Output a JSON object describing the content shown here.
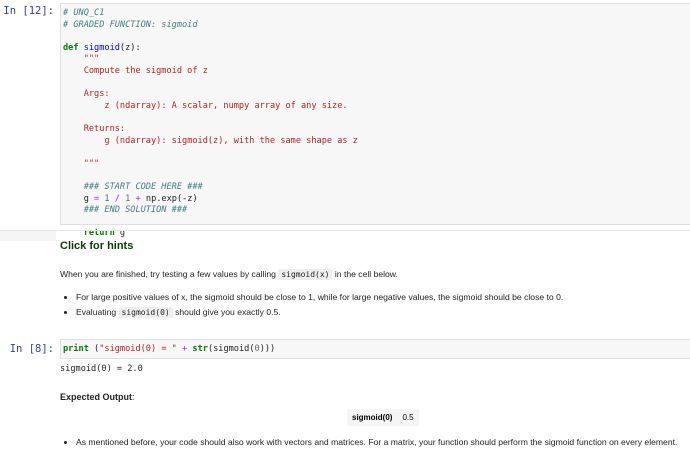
{
  "cell1": {
    "prompt": "In [12]:",
    "lines": [
      [
        {
          "t": "# UNQ_C1",
          "c": "cm"
        }
      ],
      [
        {
          "t": "# GRADED FUNCTION: sigmoid",
          "c": "cm"
        }
      ],
      [
        {
          "t": ""
        }
      ],
      [
        {
          "t": "def ",
          "c": "kw"
        },
        {
          "t": "sigmoid",
          "c": "fn"
        },
        {
          "t": "(z):"
        }
      ],
      [
        {
          "t": "    "
        },
        {
          "t": "\"\"\"",
          "c": "str"
        }
      ],
      [
        {
          "t": "    "
        },
        {
          "t": "Compute the sigmoid of z",
          "c": "str"
        }
      ],
      [
        {
          "t": ""
        }
      ],
      [
        {
          "t": "    "
        },
        {
          "t": "Args:",
          "c": "str"
        }
      ],
      [
        {
          "t": "        "
        },
        {
          "t": "z (ndarray): A scalar, numpy array of any size.",
          "c": "str"
        }
      ],
      [
        {
          "t": ""
        }
      ],
      [
        {
          "t": "    "
        },
        {
          "t": "Returns:",
          "c": "str"
        }
      ],
      [
        {
          "t": "        "
        },
        {
          "t": "g (ndarray): sigmoid(z), with the same shape as z",
          "c": "str"
        }
      ],
      [
        {
          "t": ""
        }
      ],
      [
        {
          "t": "    "
        },
        {
          "t": "\"\"\"",
          "c": "str"
        }
      ],
      [
        {
          "t": ""
        }
      ],
      [
        {
          "t": "    "
        },
        {
          "t": "### START CODE HERE ###",
          "c": "cm"
        }
      ],
      [
        {
          "t": "    g "
        },
        {
          "t": "=",
          "c": "op"
        },
        {
          "t": " "
        },
        {
          "t": "1",
          "c": "num"
        },
        {
          "t": " "
        },
        {
          "t": "/",
          "c": "op"
        },
        {
          "t": " "
        },
        {
          "t": "1",
          "c": "num"
        },
        {
          "t": " "
        },
        {
          "t": "+",
          "c": "op"
        },
        {
          "t": " np.exp(-z)"
        }
      ],
      [
        {
          "t": "    "
        },
        {
          "t": "### END SOLUTION ###",
          "c": "cm"
        }
      ],
      [
        {
          "t": ""
        }
      ],
      [
        {
          "t": "    "
        },
        {
          "t": "return",
          "c": "kw"
        },
        {
          "t": " g"
        }
      ]
    ]
  },
  "markdown": {
    "hints_label": "Click for hints",
    "intro_before": "When you are finished, try testing a few values by calling ",
    "intro_code": "sigmoid(x)",
    "intro_after": " in the cell below.",
    "bullet1": "For large positive values of x, the sigmoid should be close to 1, while for large negative values, the sigmoid should be close to 0.",
    "bullet2_before": "Evaluating ",
    "bullet2_code": "sigmoid(0)",
    "bullet2_after": " should give you exactly 0.5."
  },
  "cell2": {
    "prompt": "In [8]:",
    "lines": [
      [
        {
          "t": "print",
          "c": "kw"
        },
        {
          "t": " ("
        },
        {
          "t": "\"sigmoid(0) = \"",
          "c": "str"
        },
        {
          "t": " "
        },
        {
          "t": "+",
          "c": "op"
        },
        {
          "t": " "
        },
        {
          "t": "str",
          "c": "kw"
        },
        {
          "t": "(sigmoid("
        },
        {
          "t": "0",
          "c": "num"
        },
        {
          "t": ")))"
        }
      ]
    ],
    "output": "sigmoid(0) = 2.0"
  },
  "expected": {
    "label": "Expected Output",
    "colon": ":",
    "key": "sigmoid(0)",
    "value": "0.5",
    "bullet": "As mentioned before, your code should also work with vectors and matrices. For a matrix, your function should perform the sigmoid function on every element."
  }
}
